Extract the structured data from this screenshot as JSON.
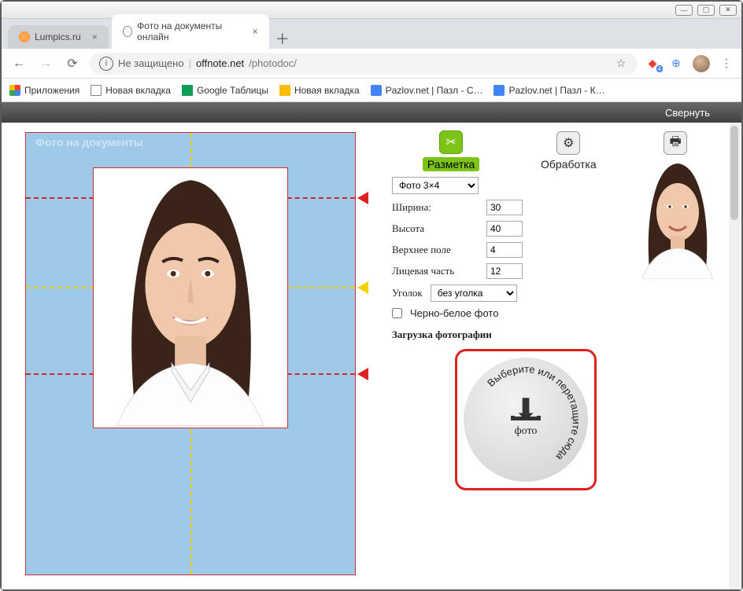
{
  "window": {
    "minimize": "—",
    "maximize": "▢",
    "close": "✕"
  },
  "tabs": [
    {
      "title": "Lumpics.ru"
    },
    {
      "title": "Фото на документы онлайн"
    }
  ],
  "addr": {
    "security": "Не защищено",
    "host": "offnote.net",
    "path": "/photodoc/"
  },
  "bookmarks": [
    {
      "label": "Приложения"
    },
    {
      "label": "Новая вкладка"
    },
    {
      "label": "Google Таблицы"
    },
    {
      "label": "Новая вкладка"
    },
    {
      "label": "Pazlov.net | Пазл - С…"
    },
    {
      "label": "Pazlov.net | Пазл - К…"
    }
  ],
  "collapse_label": "Свернуть",
  "photo_area_title": "Фото на документы",
  "steps": {
    "markup": "Разметка",
    "process": "Обработка",
    "print": "Печать"
  },
  "format": {
    "selected": "Фото 3×4"
  },
  "params": {
    "width_label": "Ширина:",
    "width_value": "30",
    "height_label": "Высота",
    "height_value": "40",
    "top_margin_label": "Верхнее поле",
    "top_margin_value": "4",
    "face_part_label": "Лицевая часть",
    "face_part_value": "12",
    "corner_label": "Уголок",
    "corner_selected": "без уголка",
    "bw_label": "Черно-белое фото"
  },
  "upload": {
    "section_title": "Загрузка фотографии",
    "hint_curve": "Выберите или перетащите сюда",
    "center_label": "фото"
  }
}
